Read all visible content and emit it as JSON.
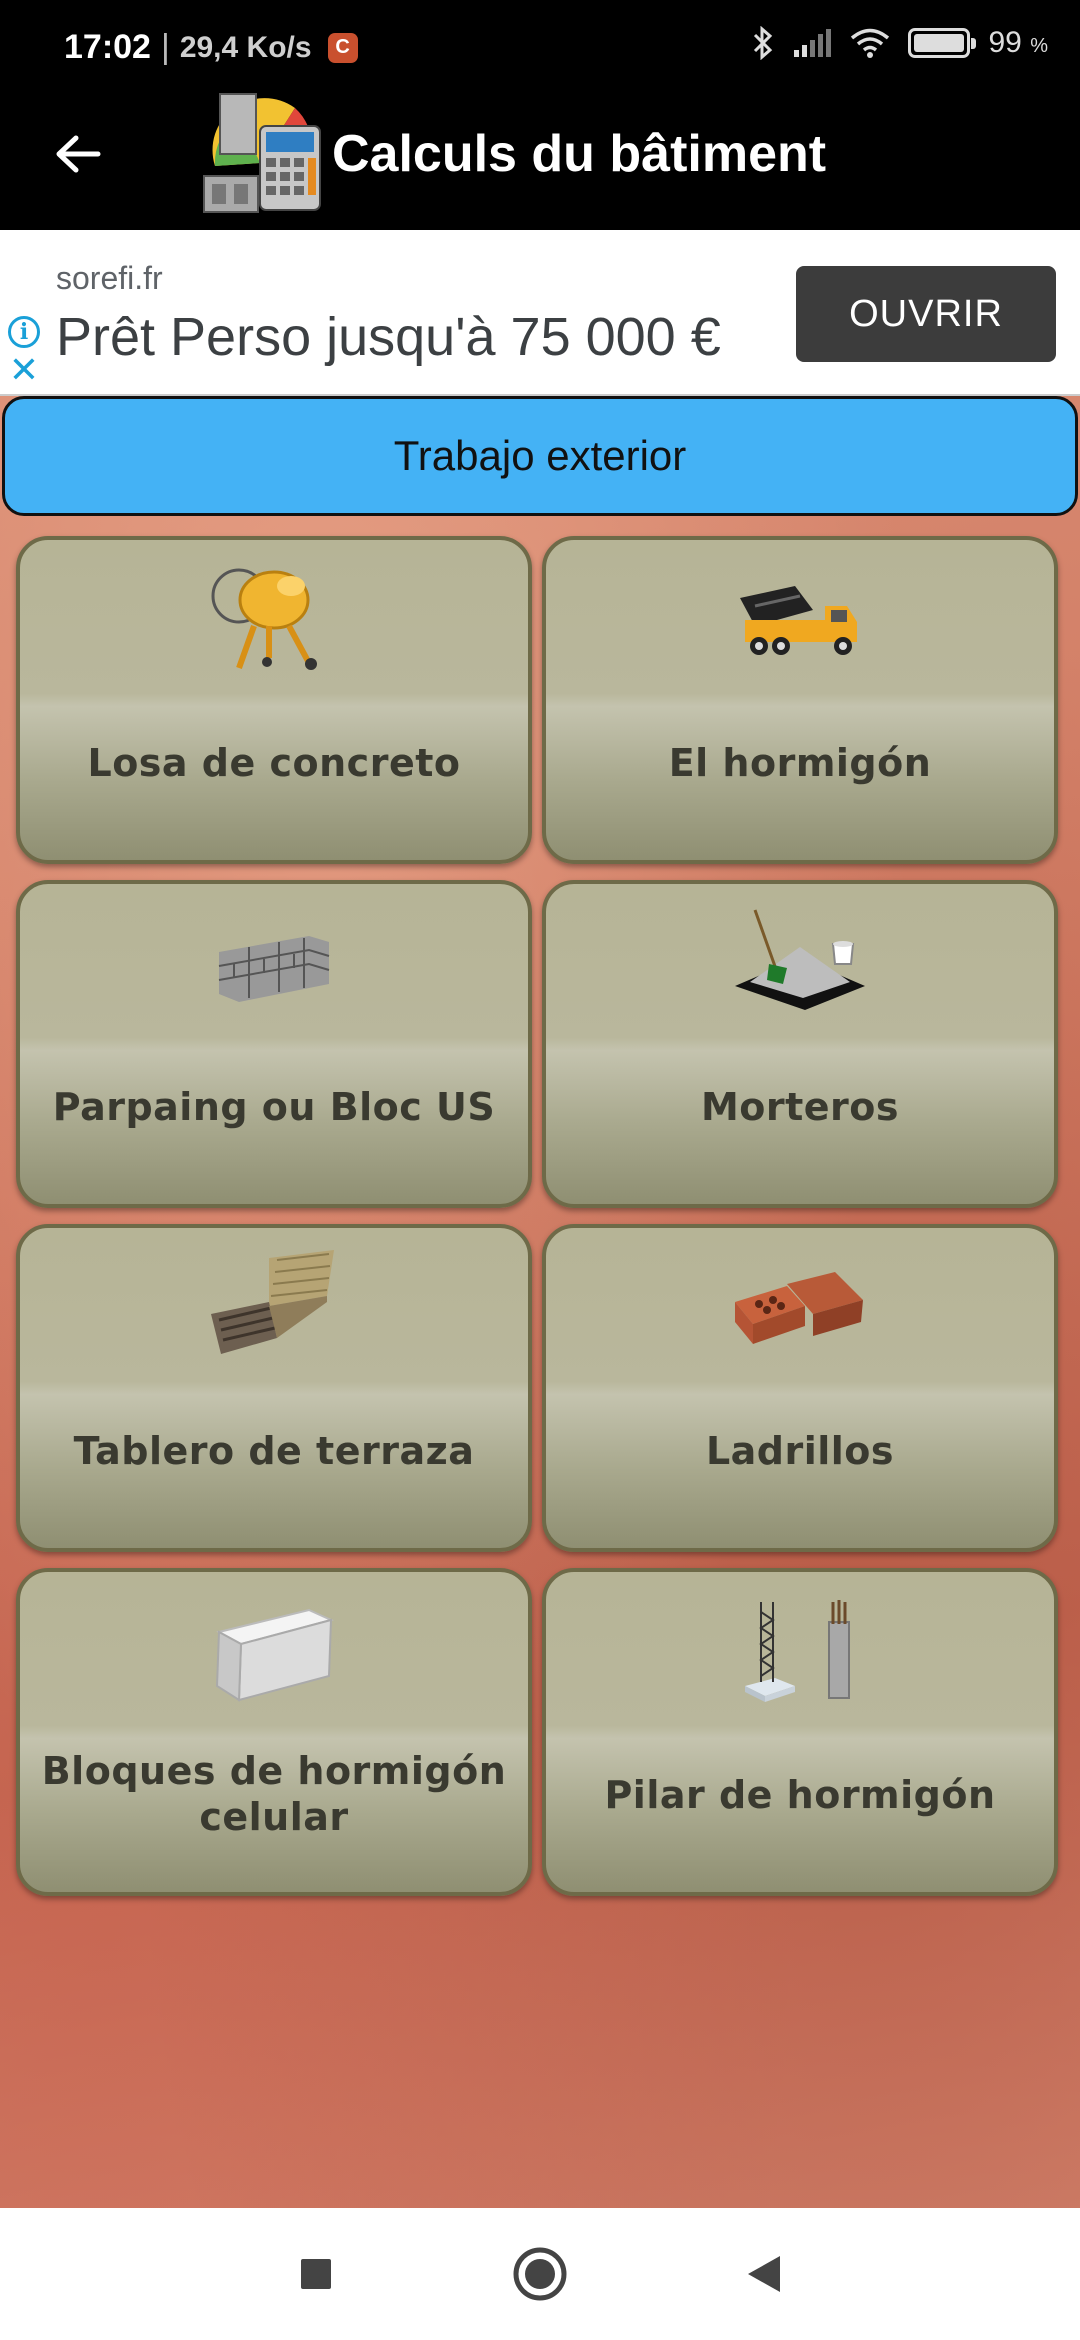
{
  "status_bar": {
    "time": "17:02",
    "separator": "|",
    "speed": "29,4 Ko/s",
    "rec_icon_letter": "C",
    "battery_level": 99,
    "battery_text": "99",
    "battery_unit": "%"
  },
  "app_bar": {
    "title": "Calculs du bâtiment"
  },
  "ad": {
    "domain": "sorefi.fr",
    "headline": "Prêt Perso jusqu'à 75 000 €",
    "cta": "OUVRIR",
    "info_glyph": "i",
    "close_glyph": "✕"
  },
  "section": {
    "title": "Trabajo exterior"
  },
  "tiles": [
    {
      "label": "Losa de concreto",
      "icon": "concrete-mixer-icon"
    },
    {
      "label": "El hormigón",
      "icon": "concrete-truck-icon"
    },
    {
      "label": "Parpaing ou Bloc US",
      "icon": "block-wall-icon"
    },
    {
      "label": "Morteros",
      "icon": "mortar-shovel-icon"
    },
    {
      "label": "Tablero de terraza",
      "icon": "deck-boards-icon"
    },
    {
      "label": "Ladrillos",
      "icon": "bricks-icon"
    },
    {
      "label": "Bloques de hormigón celular",
      "icon": "aerated-block-icon"
    },
    {
      "label": "Pilar de hormigón",
      "icon": "concrete-pillar-icon"
    }
  ],
  "colors": {
    "section_header": "#44b2f5",
    "tile_border": "#6e6a48",
    "ad_cta": "#3c3c3c"
  }
}
